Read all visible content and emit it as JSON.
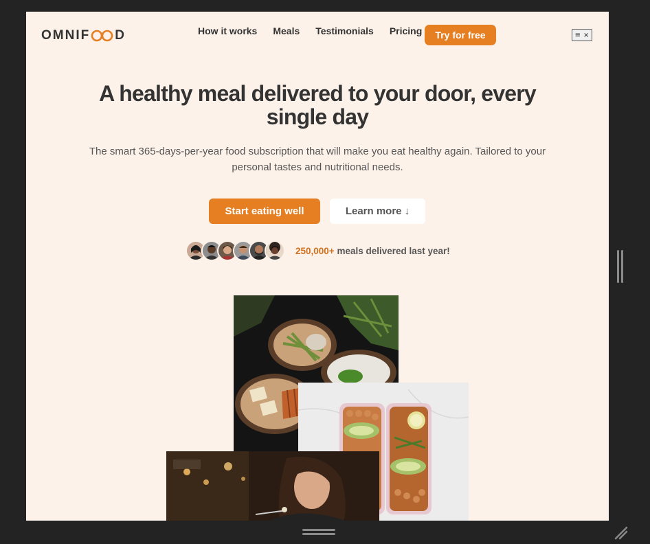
{
  "header": {
    "logo_text_left": "OMNIF",
    "logo_text_right": "D",
    "nav": [
      "How it works",
      "Meals",
      "Testimonials",
      "Pricing"
    ],
    "cta": "Try for free",
    "menu_toggle_symbols": [
      "≡",
      "×"
    ]
  },
  "hero": {
    "title": "A healthy meal delivered to your door, every single day",
    "description": "The smart 365-days-per-year food subscription that will make you eat healthy again. Tailored to your personal tastes and nutritional needs.",
    "primary_button": "Start eating well",
    "secondary_button": "Learn more ↓",
    "customers_count": "250,000+",
    "customers_text": " meals delivered last year!",
    "avatar_count": 6
  },
  "colors": {
    "accent": "#e67e22",
    "page_background": "#fdf2e9",
    "text_dark": "#333333"
  }
}
